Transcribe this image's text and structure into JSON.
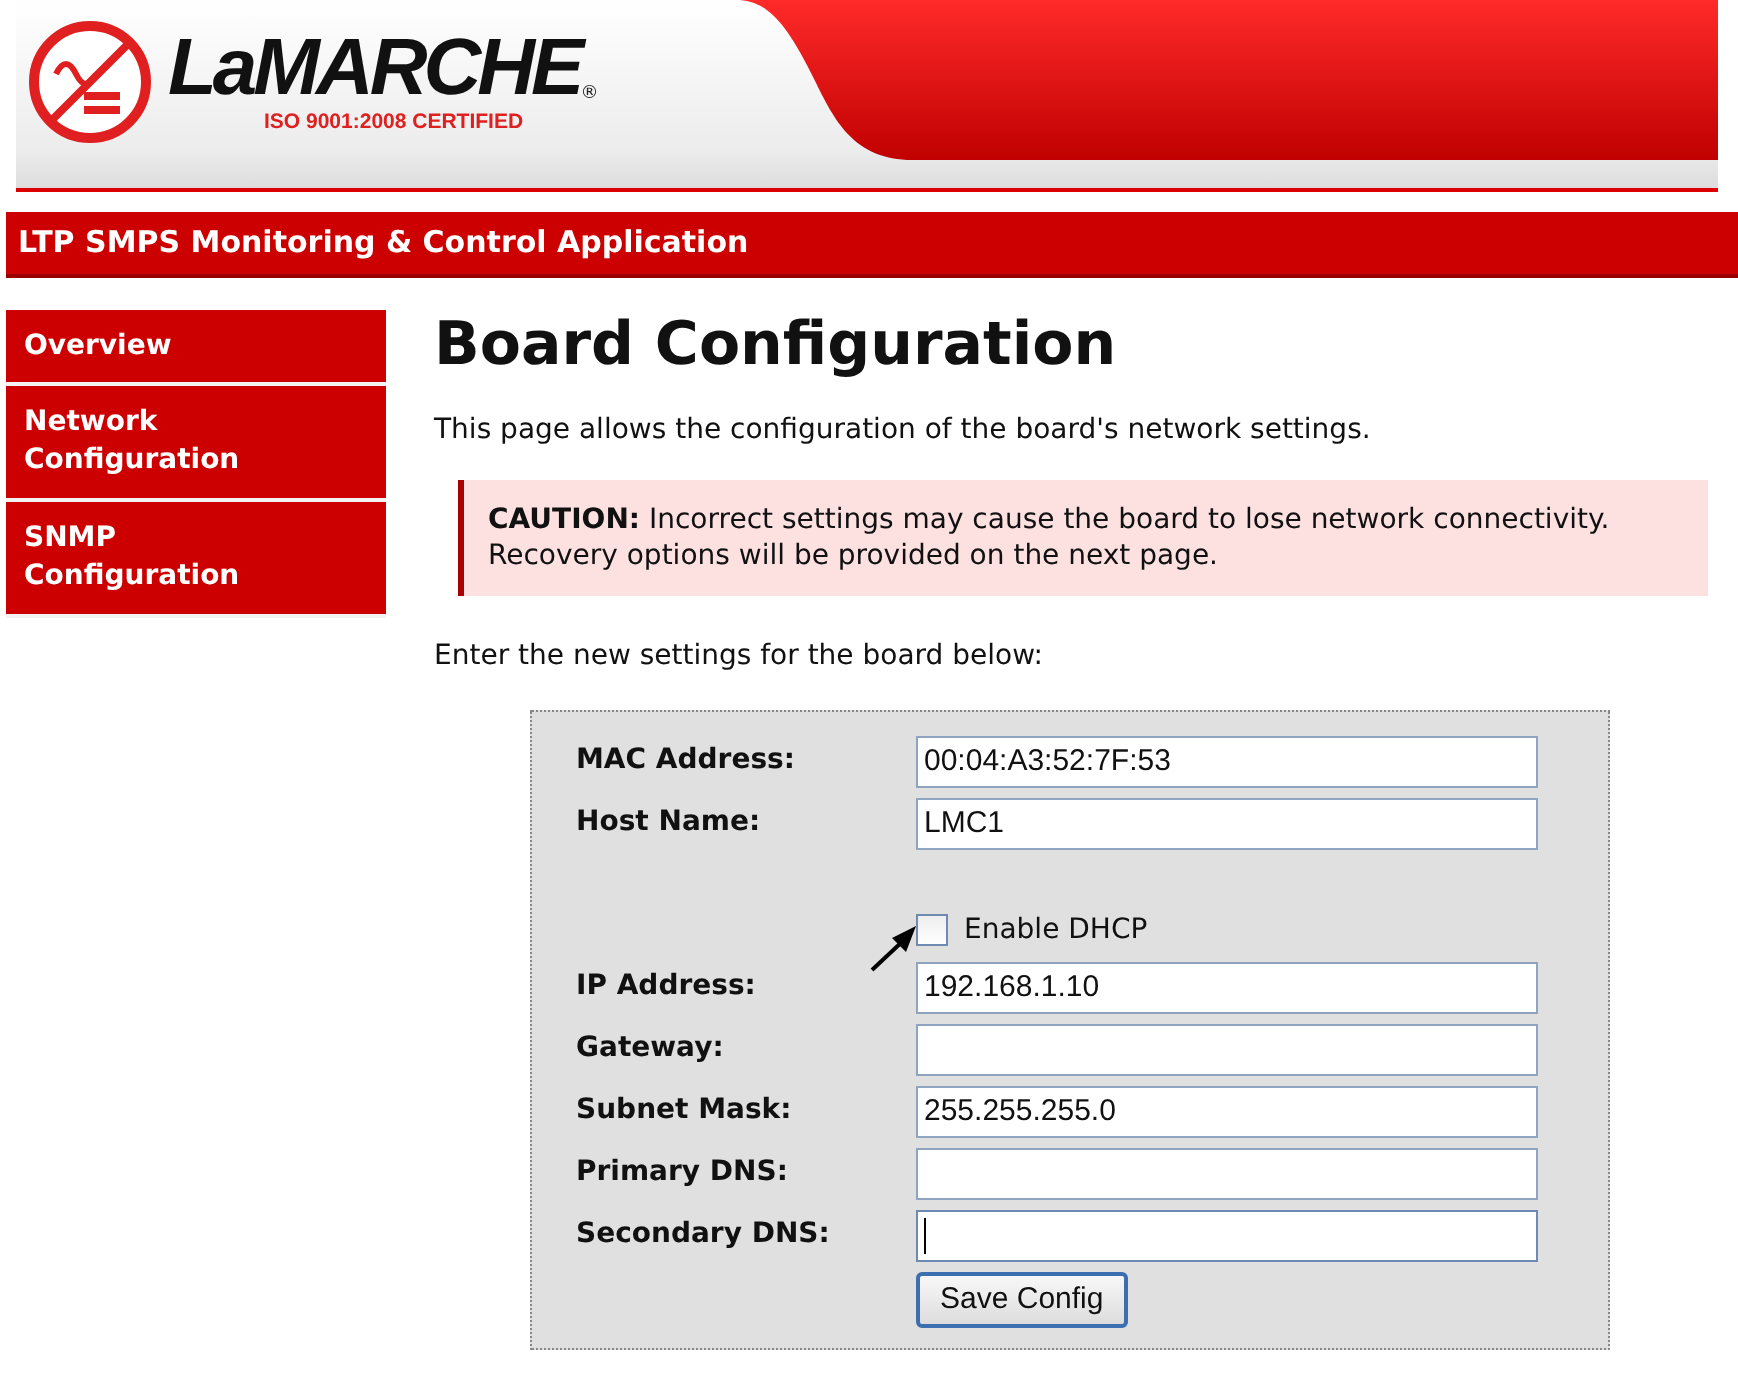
{
  "header": {
    "logo_text": "LaMARCHE",
    "registered": "®",
    "certification": "ISO 9001:2008 CERTIFIED"
  },
  "app_title": "LTP SMPS Monitoring & Control Application",
  "sidebar": {
    "items": [
      {
        "label": "Overview"
      },
      {
        "label": "Network Configuration"
      },
      {
        "label": "SNMP Configuration"
      }
    ]
  },
  "page": {
    "heading": "Board Configuration",
    "intro": "This page allows the configuration of the board's network settings.",
    "caution": "**CAUTION:** Incorrect settings may cause the board to lose network connectivity. Recovery options will be provided on the next page.",
    "prompt": "Enter the new settings for the board below:"
  },
  "form": {
    "fields": [
      {
        "kind": "text",
        "label": "MAC Address:",
        "value": "00:04:A3:52:7F:53",
        "focused": false
      },
      {
        "kind": "text",
        "label": "Host Name:",
        "value": "LMC1",
        "focused": false
      },
      {
        "kind": "checkbox",
        "label": "Enable DHCP",
        "checked": false
      },
      {
        "kind": "text",
        "label": "IP Address:",
        "value": "192.168.1.10",
        "focused": false
      },
      {
        "kind": "text",
        "label": "Gateway:",
        "focused": false
      },
      {
        "kind": "text",
        "label": "Subnet Mask:",
        "value": "255.255.255.0",
        "focused": false
      },
      {
        "kind": "text",
        "label": "Primary DNS:",
        "focused": false
      },
      {
        "kind": "text",
        "label": "Secondary DNS:",
        "focused": true
      }
    ],
    "submit": "Save Config"
  }
}
